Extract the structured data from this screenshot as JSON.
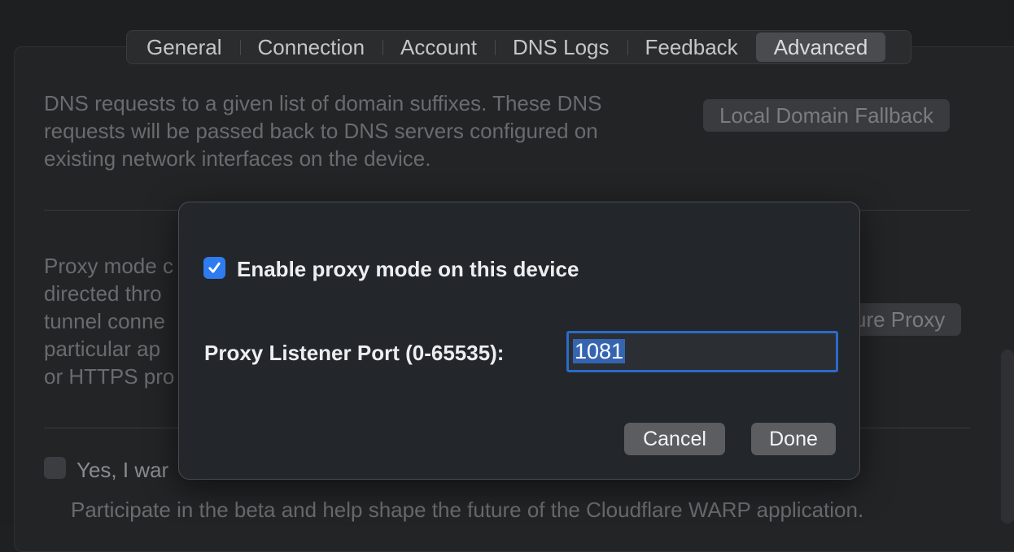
{
  "tabs": [
    {
      "label": "General"
    },
    {
      "label": "Connection"
    },
    {
      "label": "Account"
    },
    {
      "label": "DNS Logs"
    },
    {
      "label": "Feedback"
    },
    {
      "label": "Advanced",
      "active": true
    }
  ],
  "background": {
    "dns_section": {
      "lines": [
        "DNS requests to a given list of domain suffixes. These DNS",
        "requests will be passed back to DNS servers configured on",
        "existing network interfaces on the device."
      ],
      "button_label": "Local Domain Fallback"
    },
    "proxy_section": {
      "lines": [
        "Proxy mode c",
        "directed thro",
        "tunnel conne",
        "particular ap",
        "or HTTPS pro"
      ],
      "button_label": "ure Proxy"
    },
    "beta_section": {
      "checkbox_label": "Yes, I war",
      "description": "Participate in the beta and help shape the future of the Cloudflare WARP application."
    }
  },
  "dialog": {
    "enable_proxy_label": "Enable proxy mode on this device",
    "enable_proxy_checked": true,
    "port_label": "Proxy Listener Port (0-65535):",
    "port_value": "1081",
    "cancel_label": "Cancel",
    "done_label": "Done"
  },
  "colors": {
    "accent": "#2f7bf0",
    "focus_ring": "#2a6cc8",
    "selection": "#3565b0"
  }
}
